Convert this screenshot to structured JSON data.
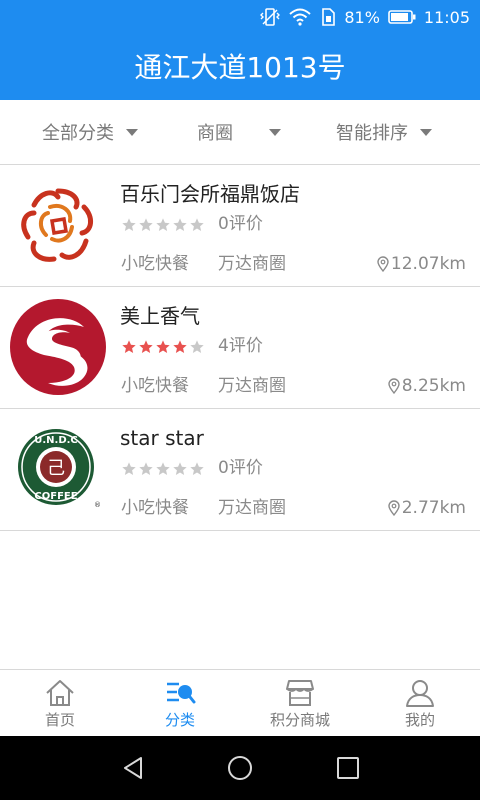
{
  "status_bar": {
    "battery_percent": "81%",
    "time": "11:05"
  },
  "header": {
    "title": "通江大道1013号"
  },
  "filters": [
    {
      "label": "全部分类"
    },
    {
      "label": "商圈"
    },
    {
      "label": "智能排序"
    }
  ],
  "stores": [
    {
      "name": "百乐门会所福鼎饭店",
      "rating": 0,
      "reviews": "0评价",
      "category": "小吃快餐",
      "area": "万达商圈",
      "distance": "12.07km"
    },
    {
      "name": "美上香气",
      "rating": 4,
      "reviews": "4评价",
      "category": "小吃快餐",
      "area": "万达商圈",
      "distance": "8.25km"
    },
    {
      "name": "star star",
      "rating": 0,
      "reviews": "0评价",
      "category": "小吃快餐",
      "area": "万达商圈",
      "distance": "2.77km"
    }
  ],
  "logo_text": {
    "undc": "U.N.D.C",
    "coffee": "COFFEE"
  },
  "tabs": [
    {
      "label": "首页",
      "icon": "home-icon"
    },
    {
      "label": "分类",
      "icon": "category-search-icon"
    },
    {
      "label": "积分商城",
      "icon": "store-icon"
    },
    {
      "label": "我的",
      "icon": "user-icon"
    }
  ],
  "active_tab": 1,
  "colors": {
    "primary": "#1e8cf0",
    "star_filled": "#e8514f",
    "star_empty": "#c8c8c8",
    "text_muted": "#8a8a8a"
  }
}
